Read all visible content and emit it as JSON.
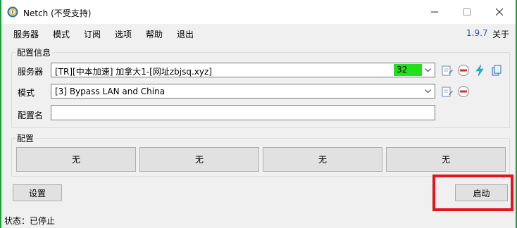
{
  "window": {
    "title": "Netch (不受支持)",
    "icon": "netch-app-icon",
    "controls": {
      "minimize": "minimize-icon",
      "maximize": "maximize-icon",
      "close": "close-icon"
    }
  },
  "menu": {
    "items": [
      {
        "label": "服务器"
      },
      {
        "label": "模式"
      },
      {
        "label": "订阅"
      },
      {
        "label": "选项"
      },
      {
        "label": "帮助"
      },
      {
        "label": "退出"
      }
    ],
    "version": "1.9.7",
    "about": "关于"
  },
  "config": {
    "group_label": "配置信息",
    "server": {
      "label": "服务器",
      "value": "[TR][中本加速] 加拿大1-[网址zbjsq.xyz]",
      "latency": "32",
      "latency_color": "#22e01c"
    },
    "mode": {
      "label": "模式",
      "value": "[3] Bypass LAN and China"
    },
    "profile_name": {
      "label": "配置名",
      "value": ""
    }
  },
  "profiles": {
    "group_label": "配置",
    "slots": [
      {
        "label": "无"
      },
      {
        "label": "无"
      },
      {
        "label": "无"
      },
      {
        "label": "无"
      }
    ]
  },
  "actions": {
    "settings": "设置",
    "start": "启动"
  },
  "status": {
    "text": "状态：已停止"
  },
  "colors": {
    "accent_border": "#1e9c3c",
    "highlight": "#e3141b",
    "version_text": "#1a5ea6"
  }
}
